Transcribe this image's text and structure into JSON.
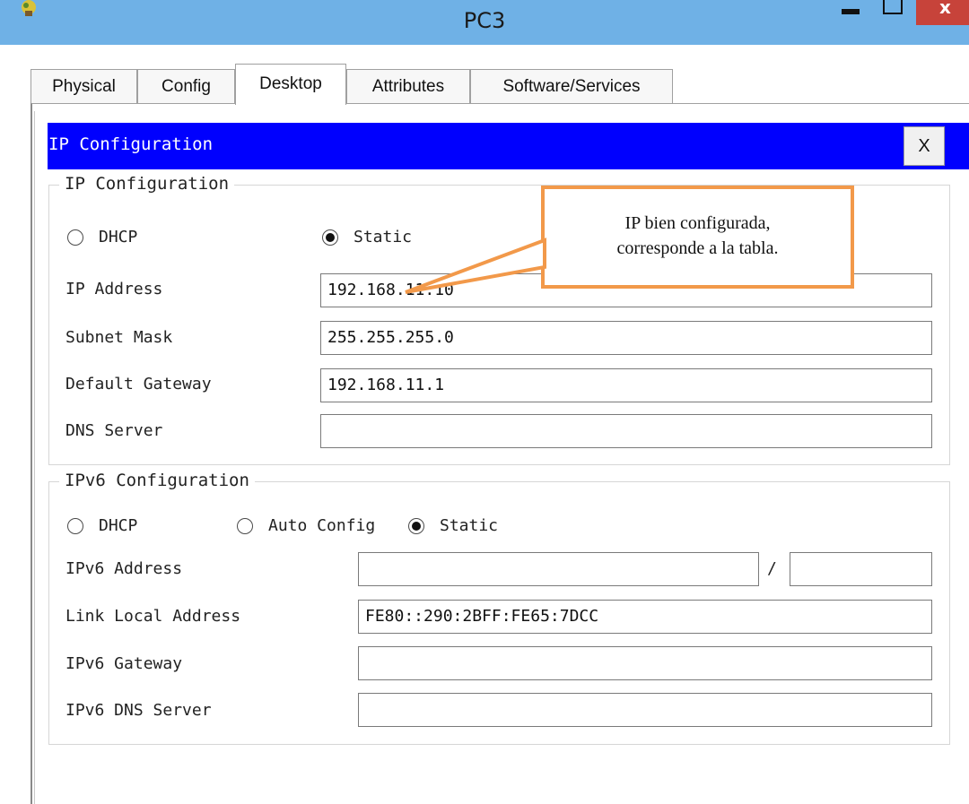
{
  "window": {
    "title": "PC3",
    "close_glyph": "x"
  },
  "tabs": [
    "Physical",
    "Config",
    "Desktop",
    "Attributes",
    "Software/Services"
  ],
  "active_tab": "Desktop",
  "panel": {
    "title": "IP Configuration",
    "close_label": "X"
  },
  "ipv4": {
    "legend": "IP Configuration",
    "mode_options": [
      "DHCP",
      "Static"
    ],
    "selected_mode": "Static",
    "ip_address_label": "IP Address",
    "ip_address": "192.168.11.10",
    "subnet_mask_label": "Subnet Mask",
    "subnet_mask": "255.255.255.0",
    "default_gateway_label": "Default Gateway",
    "default_gateway": "192.168.11.1",
    "dns_server_label": "DNS Server",
    "dns_server": ""
  },
  "ipv6": {
    "legend": "IPv6 Configuration",
    "mode_options": [
      "DHCP",
      "Auto Config",
      "Static"
    ],
    "selected_mode": "Static",
    "address_label": "IPv6 Address",
    "address": "",
    "prefix_separator": "/",
    "prefix": "",
    "link_local_label": "Link Local Address",
    "link_local": "FE80::290:2BFF:FE65:7DCC",
    "gateway_label": "IPv6 Gateway",
    "gateway": "",
    "dns_server_label": "IPv6 DNS Server",
    "dns_server": ""
  },
  "callout": {
    "line1": "IP bien configurada,",
    "line2": "corresponde a la tabla.",
    "border_color": "#f2994a"
  },
  "colors": {
    "titlebar": "#6fb1e6",
    "header_bar": "#0000fe",
    "close_button": "#c7433a"
  },
  "icons": {
    "app": "packet-tracer-pc-icon",
    "minimize": "minimize-icon",
    "maximize": "maximize-icon",
    "close": "close-icon"
  }
}
